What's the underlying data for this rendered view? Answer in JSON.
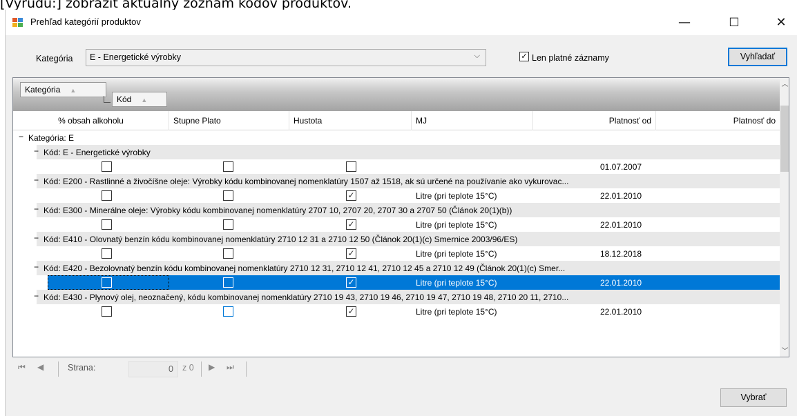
{
  "top_caption": "[Výrudu:] zobraziť aktuálny zoznam kódov produktov.",
  "window": {
    "title": "Prehľad kategórií produktov",
    "minimize": "—",
    "maximize": "☐",
    "close": "✕"
  },
  "filter": {
    "category_label": "Kategória",
    "category_value": "E - Energetické výrobky",
    "valid_only_label": "Len platné záznamy",
    "valid_only_checked": true,
    "search_button": "Vyhľadať"
  },
  "grid": {
    "group_chips": [
      "Kategória",
      "Kód"
    ],
    "columns": [
      "% obsah alkoholu",
      "Stupne Plato",
      "Hustota",
      "MJ",
      "Platnosť od",
      "Platnosť do"
    ],
    "category_group": "Kategória: E",
    "groups": [
      {
        "label": "Kód: E - Energetické výrobky",
        "alcohol": false,
        "plato": false,
        "density": false,
        "unit": "",
        "valid_from": "01.07.2007",
        "valid_to": ""
      },
      {
        "label": "Kód: E200 - Rastlinné a živočíšne oleje: Výrobky kódu kombinovanej nomenklatúry 1507 až 1518, ak sú určené na používanie ako vykurovac...",
        "alcohol": false,
        "plato": false,
        "density": true,
        "unit": "Litre (pri teplote 15°C)",
        "valid_from": "22.01.2010",
        "valid_to": ""
      },
      {
        "label": "Kód: E300 - Minerálne oleje: Výrobky kódu kombinovanej nomenklatúry 2707 10, 2707 20, 2707 30 a 2707 50 (Článok 20(1)(b))",
        "alcohol": false,
        "plato": false,
        "density": true,
        "unit": "Litre (pri teplote 15°C)",
        "valid_from": "22.01.2010",
        "valid_to": ""
      },
      {
        "label": "Kód: E410 - Olovnatý benzín kódu kombinovanej nomenklatúry 2710 12 31 a 2710 12 50 (Článok 20(1)(c) Smernice 2003/96/ES)",
        "alcohol": false,
        "plato": false,
        "density": true,
        "unit": "Litre (pri teplote 15°C)",
        "valid_from": "18.12.2018",
        "valid_to": ""
      },
      {
        "label": "Kód: E420 - Bezolovnatý benzín kódu kombinovanej nomenklatúry 2710 12 31, 2710 12 41, 2710 12 45 a 2710 12 49 (Článok 20(1)(c) Smer...",
        "alcohol": false,
        "plato": false,
        "density": true,
        "unit": "Litre (pri teplote 15°C)",
        "valid_from": "22.01.2010",
        "valid_to": "",
        "selected": true
      },
      {
        "label": "Kód: E430 - Plynový olej, neoznačený, kódu kombinovanej nomenklatúry 2710 19 43, 2710 19 46, 2710 19 47, 2710 19 48, 2710 20 11, 2710...",
        "alcohol": false,
        "plato": false,
        "density": true,
        "unit": "Litre (pri teplote 15°C)",
        "valid_from": "22.01.2010",
        "valid_to": ""
      }
    ]
  },
  "pager": {
    "page_label": "Strana:",
    "page_value": "0",
    "of_label": "z 0"
  },
  "footer": {
    "select_button": "Vybrať"
  }
}
